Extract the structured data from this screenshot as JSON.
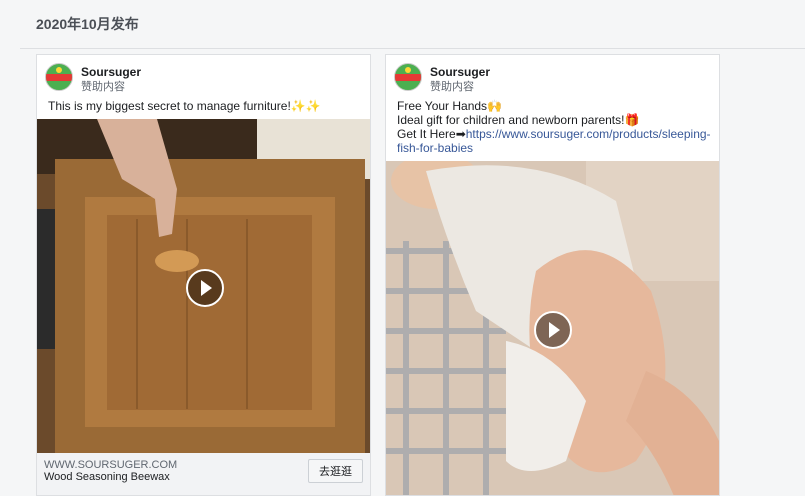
{
  "header": {
    "title": "2020年10月发布"
  },
  "posts": [
    {
      "page_name": "Soursuger",
      "sponsored": "赞助内容",
      "text_lines": [
        "This is my biggest secret to manage furniture!✨✨"
      ],
      "domain": "WWW.SOURSUGER.COM",
      "product": "Wood Seasoning Beewax",
      "cta": "去逛逛"
    },
    {
      "page_name": "Soursuger",
      "sponsored": "赞助内容",
      "line1": "Free Your Hands🙌",
      "line2": "Ideal gift for children and newborn parents!🎁",
      "line3_prefix": "Get It Here➡",
      "link_part1": "https://www.soursuger.com/products/sleeping-",
      "link_part2": "fish-for-babies"
    }
  ],
  "colors": {
    "link": "#385898",
    "border": "#dddfe2"
  }
}
